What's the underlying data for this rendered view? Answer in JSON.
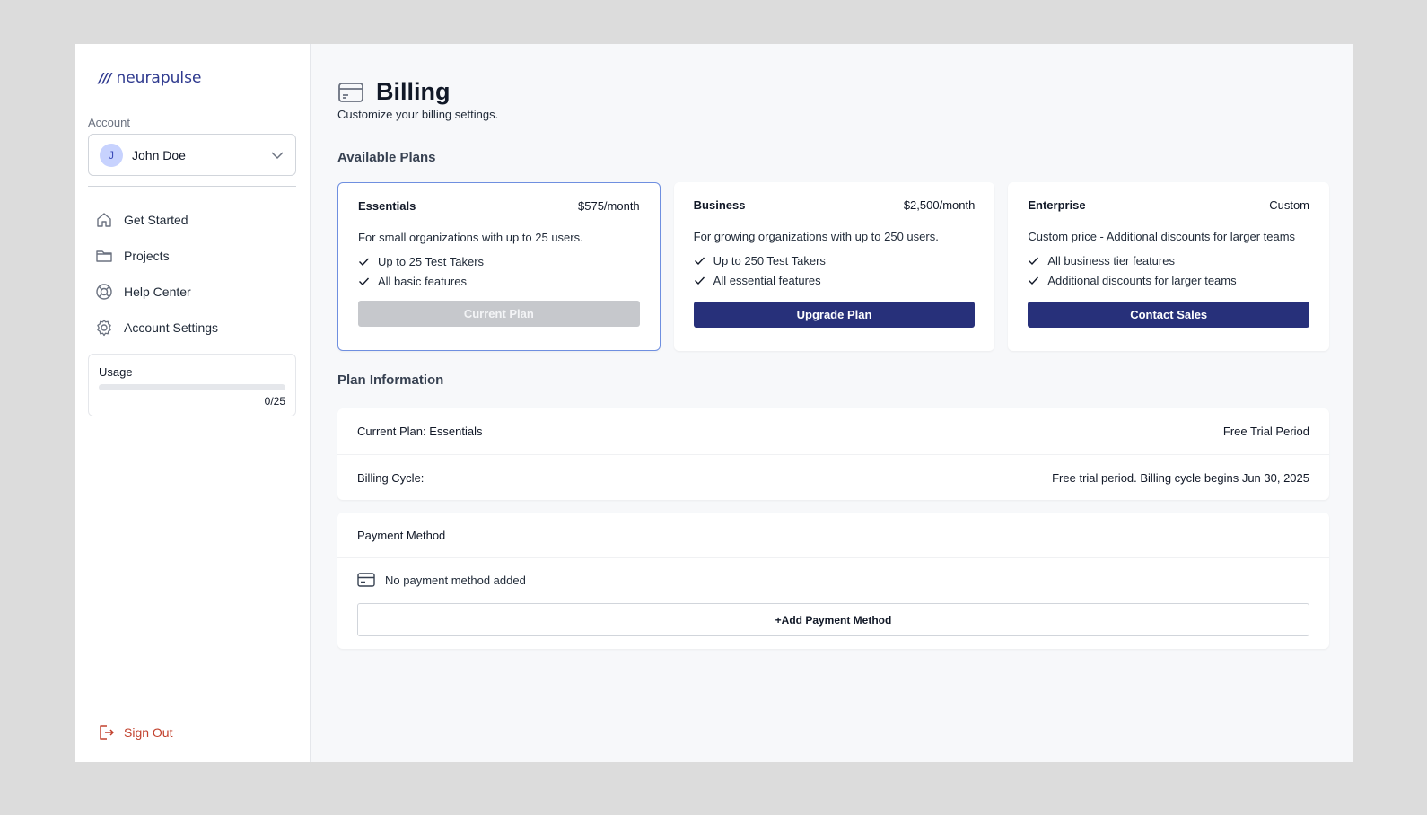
{
  "brand": {
    "mark": "///",
    "name": "neurapulse"
  },
  "account": {
    "label": "Account",
    "initial": "J",
    "name": "John Doe"
  },
  "nav": [
    {
      "label": "Get Started",
      "icon": "home-icon"
    },
    {
      "label": "Projects",
      "icon": "folder-icon"
    },
    {
      "label": "Help Center",
      "icon": "lifebuoy-icon"
    },
    {
      "label": "Account Settings",
      "icon": "gear-icon"
    }
  ],
  "usage": {
    "label": "Usage",
    "count": "0/25",
    "fraction": 0
  },
  "signout": {
    "label": "Sign Out"
  },
  "page": {
    "title": "Billing",
    "subtitle": "Customize your billing settings."
  },
  "plans_section": {
    "title": "Available Plans"
  },
  "plans": [
    {
      "name": "Essentials",
      "price": "$575/month",
      "description": "For small organizations with up to 25 users.",
      "features": [
        "Up to 25 Test Takers",
        "All basic features"
      ],
      "button": "Current Plan"
    },
    {
      "name": "Business",
      "price": "$2,500/month",
      "description": "For growing organizations with up to 250 users.",
      "features": [
        "Up to 250 Test Takers",
        "All essential features"
      ],
      "button": "Upgrade Plan"
    },
    {
      "name": "Enterprise",
      "price": "Custom",
      "description": "Custom price - Additional discounts for larger teams",
      "features": [
        "All business tier features",
        "Additional discounts for larger teams"
      ],
      "button": "Contact Sales"
    }
  ],
  "plan_info": {
    "title": "Plan Information",
    "current_plan": "Current Plan: Essentials",
    "status": "Free Trial Period",
    "billing_label": "Billing Cycle:",
    "billing_value": "Free trial period. Billing cycle begins Jun 30, 2025"
  },
  "payment": {
    "title": "Payment Method",
    "empty": "No payment method added",
    "add_button": "+Add Payment Method"
  },
  "colors": {
    "brand": "#2f3a8f",
    "primary_button": "#27307a",
    "danger": "#c2412d",
    "selected_border": "#6f8fe0"
  }
}
